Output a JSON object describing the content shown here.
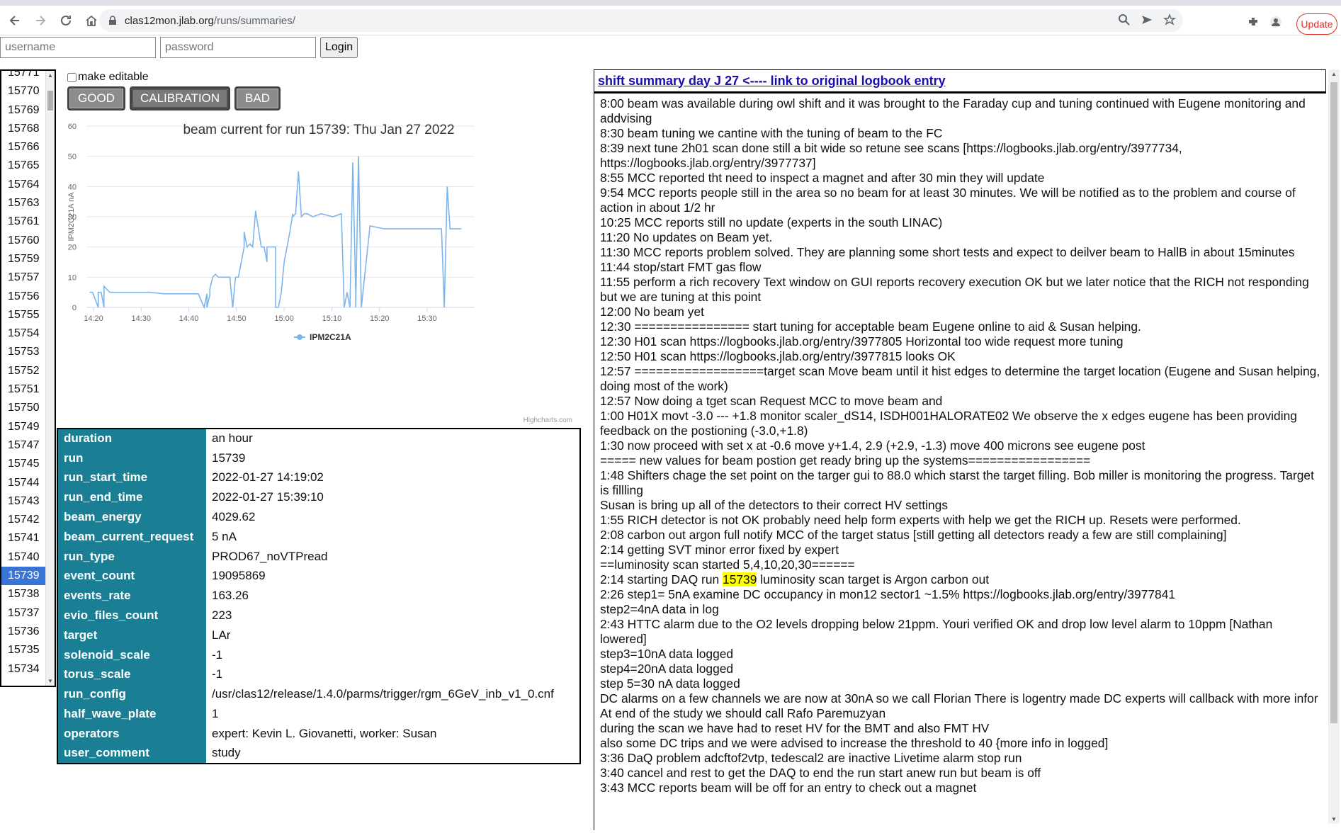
{
  "browser": {
    "url_host": "clas12mon.jlab.org",
    "url_path": "/runs/summaries/",
    "update_label": "Update"
  },
  "login": {
    "username_placeholder": "username",
    "password_placeholder": "password",
    "button_label": "Login"
  },
  "runs": {
    "items": [
      "15771",
      "15770",
      "15769",
      "15768",
      "15766",
      "15765",
      "15764",
      "15763",
      "15761",
      "15760",
      "15759",
      "15757",
      "15756",
      "15755",
      "15754",
      "15753",
      "15752",
      "15751",
      "15750",
      "15749",
      "15747",
      "15745",
      "15744",
      "15743",
      "15742",
      "15741",
      "15740",
      "15739",
      "15738",
      "15737",
      "15736",
      "15735",
      "15734"
    ],
    "selected": "15739"
  },
  "controls": {
    "make_editable_label": "make editable",
    "good_label": "GOOD",
    "calibration_label": "CALIBRATION",
    "bad_label": "BAD",
    "active_quality": "CALIBRATION"
  },
  "chart_data": {
    "type": "line",
    "title": "beam current for run 15739: Thu Jan 27 2022",
    "ylabel": "IPM2C21A nA",
    "xlabel": "",
    "ylim": [
      0,
      60
    ],
    "yticks": [
      0,
      10,
      20,
      30,
      40,
      50,
      60
    ],
    "xlim": [
      14.3,
      15.65
    ],
    "xticks": [
      "14:20",
      "14:30",
      "14:40",
      "14:50",
      "15:00",
      "15:10",
      "15:20",
      "15:30"
    ],
    "grid": true,
    "legend": "bottom-center",
    "credit": "Highcharts.com",
    "series": [
      {
        "name": "IPM2C21A",
        "color": "#7cb5ec",
        "x": [
          14.32,
          14.33,
          14.35,
          14.35,
          14.36,
          14.37,
          14.37,
          14.39,
          14.4,
          14.42,
          14.47,
          14.53,
          14.58,
          14.63,
          14.7,
          14.72,
          14.73,
          14.73,
          14.74,
          14.74,
          14.75,
          14.75,
          14.76,
          14.77,
          14.78,
          14.8,
          14.81,
          14.82,
          14.82,
          14.83,
          14.84,
          14.85,
          14.86,
          14.86,
          14.87,
          14.88,
          14.89,
          14.9,
          14.92,
          14.93,
          14.94,
          14.94,
          14.95,
          14.96,
          14.97,
          14.97,
          14.98,
          14.99,
          15.0,
          15.01,
          15.02,
          15.03,
          15.03,
          15.04,
          15.05,
          15.06,
          15.07,
          15.08,
          15.1,
          15.13,
          15.17,
          15.2,
          15.21,
          15.22,
          15.23,
          15.24,
          15.25,
          15.25,
          15.26,
          15.27,
          15.3,
          15.35,
          15.4,
          15.45,
          15.5,
          15.55,
          15.56,
          15.57,
          15.58,
          15.62
        ],
        "y": [
          5,
          5,
          0,
          5,
          5,
          0,
          7,
          5,
          5,
          5,
          5,
          5,
          4.5,
          4.5,
          4.5,
          0,
          4.5,
          0,
          4,
          6,
          10,
          10,
          11,
          10,
          10,
          10,
          10,
          0,
          0,
          10,
          10,
          15,
          20,
          25,
          20,
          21,
          20,
          32,
          20,
          20,
          15,
          20,
          20,
          20,
          20,
          0,
          0,
          5,
          15,
          20,
          25,
          31,
          30,
          31,
          45,
          30,
          31,
          31,
          30,
          31,
          30,
          31,
          0,
          5,
          0,
          48,
          5,
          0,
          50,
          0,
          27,
          26,
          26,
          26,
          26,
          26,
          0,
          40,
          26,
          26
        ]
      }
    ]
  },
  "run_info": [
    {
      "key": "duration",
      "value": "an hour"
    },
    {
      "key": "run",
      "value": "15739"
    },
    {
      "key": "run_start_time",
      "value": "2022-01-27 14:19:02"
    },
    {
      "key": "run_end_time",
      "value": "2022-01-27 15:39:10"
    },
    {
      "key": "beam_energy",
      "value": "4029.62"
    },
    {
      "key": "beam_current_request",
      "value": "5 nA"
    },
    {
      "key": "run_type",
      "value": "PROD67_noVTPread"
    },
    {
      "key": "event_count",
      "value": "19095869"
    },
    {
      "key": "events_rate",
      "value": "163.26"
    },
    {
      "key": "evio_files_count",
      "value": "223"
    },
    {
      "key": "target",
      "value": "LAr"
    },
    {
      "key": "solenoid_scale",
      "value": "-1"
    },
    {
      "key": "torus_scale",
      "value": "-1"
    },
    {
      "key": "run_config",
      "value": "/usr/clas12/release/1.4.0/parms/trigger/rgm_6GeV_inb_v1_0.cnf"
    },
    {
      "key": "half_wave_plate",
      "value": "1"
    },
    {
      "key": "operators",
      "value": "expert: Kevin L. Giovanetti, worker: Susan"
    },
    {
      "key": "user_comment",
      "value": "study"
    }
  ],
  "summary": {
    "header_link": "shift summary day J 27 <---- link to original logbook entry",
    "lines": [
      "8:00 beam was available during owl shift and it was brought to the Faraday cup and tuning continued with Eugene monitoring and addvising",
      "8:30 beam tuning we cantine with the tuning of beam to the FC",
      "8:39 next tune 2h01 scan done still a bit wide so retune see scans [https://logbooks.jlab.org/entry/3977734, https://logbooks.jlab.org/entry/3977737]",
      "8:55 MCC reported tht need to inspect a magnet and after 30 min they will update",
      "9:54 MCC reports people still in the area so no beam for at least 30 minutes. We will be notified as to the problem and course of action in about 1/2 hr",
      "10:25 MCC reports still no update (experts in the south LINAC)",
      "11:20 No updates on Beam yet.",
      "11:30 MCC reports problem solved. They are planning some short tests and expect to deilver beam to HallB in about 15minutes",
      "11:44 stop/start FMT gas flow",
      "11:55 perform a rich recovery Text window on GUI reports recovery execution OK but we later notice that the RICH not responding but we are tuning at this point",
      "12:00 No beam yet",
      "12:30 ================ start tuning for acceptable beam Eugene online to aid & Susan helping.",
      "12:30 H01 scan https://logbooks.jlab.org/entry/3977805 Horizontal too wide request more tuning",
      "12:50 H01 scan https://logbooks.jlab.org/entry/3977815 looks OK",
      "12:57 ==================target scan Move beam until it hist edges to determine the target location (Eugene and Susan helping, doing most of the work)",
      "12:57 Now doing a tget scan Request MCC to move beam and",
      "1:00 H01X movt -3.0 --- +1.8 monitor scaler_dS14, ISDH001HALORATE02 We observe the x edges eugene has been providing feedback on the postioning (-3.0,+1.8)",
      "1:30 now proceed with set x at -0.6 move y+1.4, 2.9 (+2.9, -1.3) move 400 microns see eugene post",
      "===== new values for beam postion get ready bring up the systems=================",
      "1:48 Shifters chage the set point on the targer gui to 88.0 which starst the target filling. Bob miller is monitoring the progress. Target is fillling",
      "Susan is bring up all of the detectors to their correct HV settings",
      "1:55 RICH detector is not OK probably need help form experts with help we get the RICH up. Resets were performed.",
      "2:08 carbon out argon full notify MCC of the target status [still getting all detectors ready a few are still complaining]",
      "2:14 getting SVT minor error fixed by expert",
      "==luminosity scan started 5,4,10,20,30======",
      "@@HL@@",
      "2:26 step1= 5nA examine DC occupancy in mon12 sector1 ~1.5% https://logbooks.jlab.org/entry/3977841",
      "step2=4nA data in log",
      "2:43 HTTC alarm due to the O2 levels dropping below 21ppm. Youri verified OK and drop low level alarm to 10ppm [Nathan lowered]",
      "step3=10nA data logged",
      "step4=20nA data logged",
      "step 5=30 nA data logged",
      "DC alarms on a few channels we are now at 30nA so we call Florian There is logentry made DC experts will callback with more infor",
      "At end of the study we should call Rafo Paremuzyan",
      "during the scan we have had to reset HV for the BMT and also FMT HV",
      "also some DC trips and we were advised to increase the threshold to 40 {more info in logged]",
      "3:36 DaQ problem adcftof2vtp, tedescal2 are inactive Livetime alarm stop run",
      "3:40 cancel and rest to get the DAQ to end the run start anew run but beam is off",
      "3:43 MCC reports beam will be off for an entry to check out a magnet"
    ],
    "highlight_line": {
      "before": "2:14 starting DAQ run ",
      "highlight": "15739",
      "after": " luminosity scan target is Argon carbon out"
    }
  }
}
